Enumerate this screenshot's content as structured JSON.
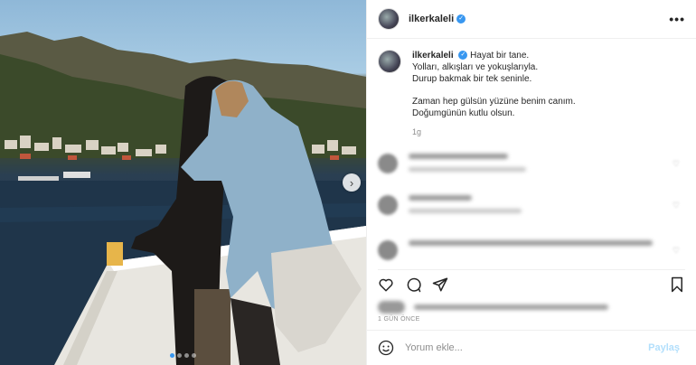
{
  "post": {
    "username": "ilkerkaleli",
    "verified_icon": "verified-badge-icon",
    "more_icon": "more-options-icon",
    "more_glyph": "•••"
  },
  "caption": {
    "username": "ilkerkaleli",
    "lines": [
      "Hayat bir tane.",
      "Yolları, alkışları ve yokuşlarıyla.",
      "Durup bakmak bir tek seninle.",
      "Zaman hep gülsün yüzüne benim canım.",
      "Doğumgünün kutlu olsun."
    ],
    "time": "1g"
  },
  "carousel": {
    "next_glyph": "›",
    "slides": 4,
    "active_index": 0
  },
  "actions": {
    "icons": [
      "heart-icon",
      "comment-icon",
      "share-icon",
      "bookmark-icon"
    ]
  },
  "meta": {
    "age": "1 GÜN ÖNCE"
  },
  "add_comment": {
    "placeholder": "Yorum ekle...",
    "post_label": "Paylaş",
    "emoji_icon": "emoji-icon"
  },
  "colors": {
    "accent": "#3897f0",
    "post_button_disabled": "#b2dffc",
    "secondary_text": "#8e8e8e"
  }
}
